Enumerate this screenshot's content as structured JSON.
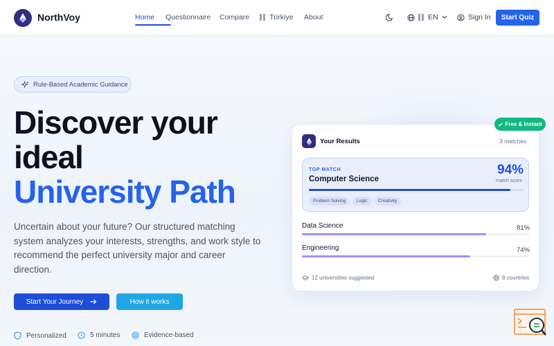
{
  "header": {
    "brand": "NorthVoy",
    "nav": [
      {
        "label": "Home",
        "active": true
      },
      {
        "label": "Questionnaire"
      },
      {
        "label": "Compare"
      },
      {
        "label": "Türkiye"
      },
      {
        "label": "About"
      }
    ],
    "lang": "EN",
    "sign_in": "Sign In",
    "start_quiz": "Start Quiz"
  },
  "hero": {
    "badge": "Rule-Based Academic Guidance",
    "title_line1": "Discover your",
    "title_line2": "ideal",
    "title_line3": "University Path",
    "description": "Uncertain about your future? Our structured matching system analyzes your interests, strengths, and work style to recommend the perfect university major and career direction.",
    "primary_button": "Start Your Journey",
    "secondary_button": "How it works",
    "features": [
      "Personalized",
      "5 minutes",
      "Evidence-based"
    ]
  },
  "results_card": {
    "pill": "Free & Instant",
    "title": "Your Results",
    "matches": "3 matches",
    "top_match": {
      "label": "TOP MATCH",
      "name": "Computer Science",
      "score": "94%",
      "score_value": 94,
      "score_label": "match score",
      "tags": [
        "Problem Solving",
        "Logic",
        "Creativity"
      ]
    },
    "others": [
      {
        "name": "Data Science",
        "pct": "81%",
        "value": 81
      },
      {
        "name": "Engineering",
        "pct": "74%",
        "value": 74
      }
    ],
    "footer_left": "12 universities suggested",
    "footer_right": "8 countries"
  },
  "colors": {
    "primary": "#2563eb",
    "secondary": "#1ea7e4",
    "success": "#10b981",
    "accent_bar": "#a78bfa"
  }
}
